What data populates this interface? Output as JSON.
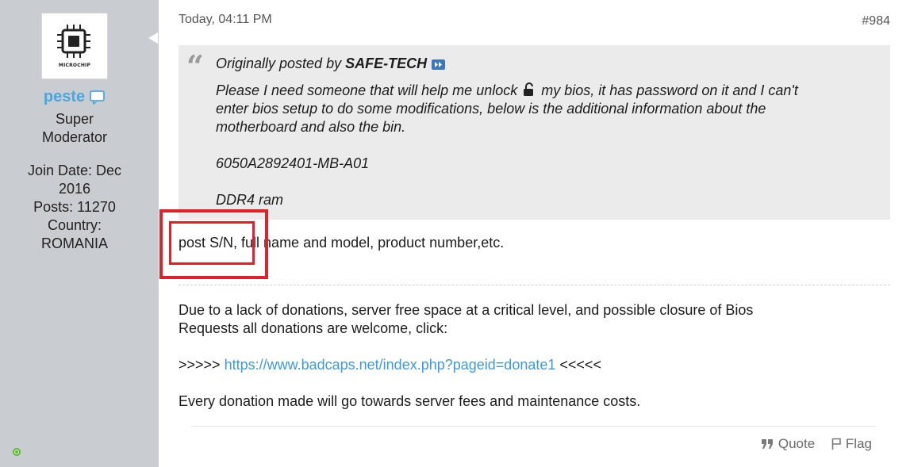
{
  "user": {
    "avatar_text": "MICROCHIP",
    "username": "peste",
    "title_line1": "Super",
    "title_line2": "Moderator",
    "join_date_line1": "Join Date: Dec",
    "join_date_line2": "2016",
    "posts": "Posts: 11270",
    "country_label": "Country:",
    "country": "ROMANIA",
    "online_color": "#5cb82a",
    "username_color": "#49a7df"
  },
  "post": {
    "date": "Today, 04:11 PM",
    "number": "#984",
    "quote": {
      "prefix": "Originally posted by",
      "author": "SAFE-TECH",
      "line1_before_icon": "Please I need someone that will help me unlock",
      "line1_after_icon": "my bios, it has password on it and I can't",
      "line2": "enter bios setup to do some modifications, below is the additional information about the",
      "line3": "motherboard and also the bin.",
      "line4": "6050A2892401-MB-A01",
      "line5": "DDR4 ram"
    },
    "reply": "post S/N, full name and model, product number,etc.",
    "signature": {
      "line1": "Due to a lack of donations, server free space at a critical level, and possible closure of Bios",
      "line2": "Requests all donations are welcome, click:",
      "link_prefix": ">>>>> ",
      "link": "https://www.badcaps.net/index.php?pageid=donate1",
      "link_suffix": " <<<<<",
      "line4": "Every donation made will go towards server fees and maintenance costs."
    },
    "actions": {
      "quote_label": "Quote",
      "flag_label": "Flag"
    }
  },
  "icons": [
    "speech-bubble-icon",
    "view-post-icon",
    "lock-open-icon",
    "quote-icon",
    "flag-icon"
  ],
  "colors": {
    "sidebar_bg": "#c9ccd0",
    "quote_bg": "#ebebeb",
    "link": "#3f9ad7",
    "highlight": "#e0212a"
  }
}
